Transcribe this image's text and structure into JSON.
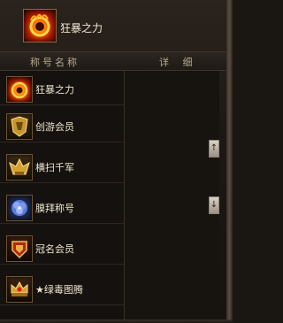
{
  "header": {
    "title": "狂暴之力",
    "icon": "flame-ring-icon"
  },
  "columns": {
    "name": "称号名称",
    "detail": "详 细"
  },
  "titles": [
    {
      "label": "狂暴之力",
      "icon": "flame-ring-icon"
    },
    {
      "label": "创游会员",
      "icon": "gold-crest-icon"
    },
    {
      "label": "横扫千军",
      "icon": "winged-crown-icon"
    },
    {
      "label": "膜拜称号",
      "icon": "blue-rose-icon"
    },
    {
      "label": "冠名会员",
      "icon": "red-gold-shield-icon"
    },
    {
      "label": "★绿毒图腾",
      "icon": "jeweled-crown-icon"
    }
  ],
  "scrollbar": {
    "up_icon": "scroll-up-arrow-icon",
    "down_icon": "scroll-down-arrow-icon"
  },
  "colors": {
    "text": "#f0e6cf",
    "header_text": "#b7a98f",
    "border": "#3a3128"
  }
}
